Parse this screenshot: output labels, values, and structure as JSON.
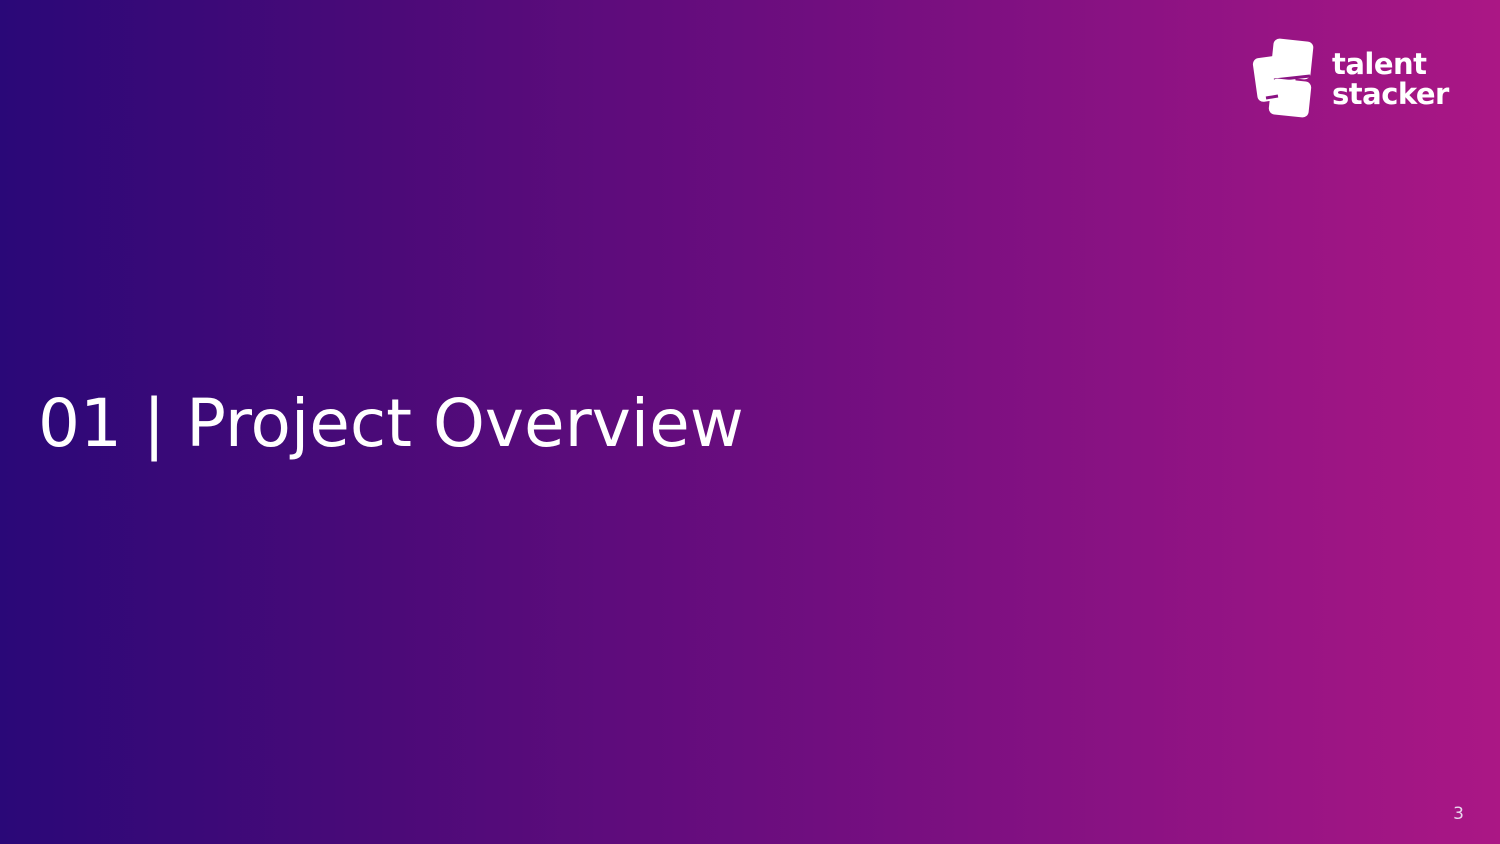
{
  "slide": {
    "title": "01 | Project Overview",
    "page_number": "3"
  },
  "logo": {
    "line1": "talent",
    "line2": "stacker",
    "icon": "stacked-cards-logo-icon"
  },
  "colors": {
    "gradient_start": "#2a0878",
    "gradient_end": "#ab1785",
    "text": "#ffffff"
  }
}
